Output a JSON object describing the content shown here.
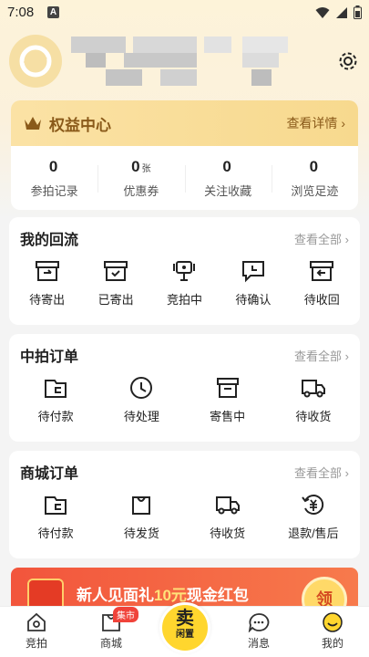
{
  "status_bar": {
    "time": "7:08",
    "notification": "A"
  },
  "vip": {
    "title": "权益中心",
    "more": "查看详情 ›"
  },
  "stats": [
    {
      "value": "0",
      "unit": "",
      "label": "参拍记录"
    },
    {
      "value": "0",
      "unit": "张",
      "label": "优惠券"
    },
    {
      "value": "0",
      "unit": "",
      "label": "关注收藏"
    },
    {
      "value": "0",
      "unit": "",
      "label": "浏览足迹"
    }
  ],
  "sections": [
    {
      "title": "我的回流",
      "more": "查看全部 ›",
      "items": [
        {
          "label": "待寄出",
          "icon": "box-out-icon"
        },
        {
          "label": "已寄出",
          "icon": "box-check-icon"
        },
        {
          "label": "竞拍中",
          "icon": "auction-icon"
        },
        {
          "label": "待确认",
          "icon": "chat-check-icon"
        },
        {
          "label": "待收回",
          "icon": "box-return-icon"
        }
      ]
    },
    {
      "title": "中拍订单",
      "more": "查看全部 ›",
      "items": [
        {
          "label": "待付款",
          "icon": "wallet-icon"
        },
        {
          "label": "待处理",
          "icon": "clock-icon"
        },
        {
          "label": "寄售中",
          "icon": "store-icon"
        },
        {
          "label": "待收货",
          "icon": "truck-icon"
        }
      ]
    },
    {
      "title": "商城订单",
      "more": "查看全部 ›",
      "items": [
        {
          "label": "待付款",
          "icon": "wallet-icon"
        },
        {
          "label": "待发货",
          "icon": "bag-icon"
        },
        {
          "label": "待收货",
          "icon": "truck-icon"
        },
        {
          "label": "退款/售后",
          "icon": "refund-icon"
        }
      ]
    }
  ],
  "banner": {
    "text_a": "新人见面礼",
    "text_b": "10元",
    "text_c": "现金红包",
    "coin": "领"
  },
  "tabbar": {
    "tabs": [
      {
        "label": "竞拍",
        "icon": "home-icon"
      },
      {
        "label": "商城",
        "icon": "shop-icon",
        "badge": "集市"
      },
      {
        "label": "消息",
        "icon": "message-icon"
      },
      {
        "label": "我的",
        "icon": "profile-icon"
      }
    ],
    "sell_big": "卖",
    "sell_small": "闲置"
  },
  "colors": {
    "accent": "#ffd62e",
    "vip_text": "#8a5a1a",
    "banner": "#f2553c"
  }
}
